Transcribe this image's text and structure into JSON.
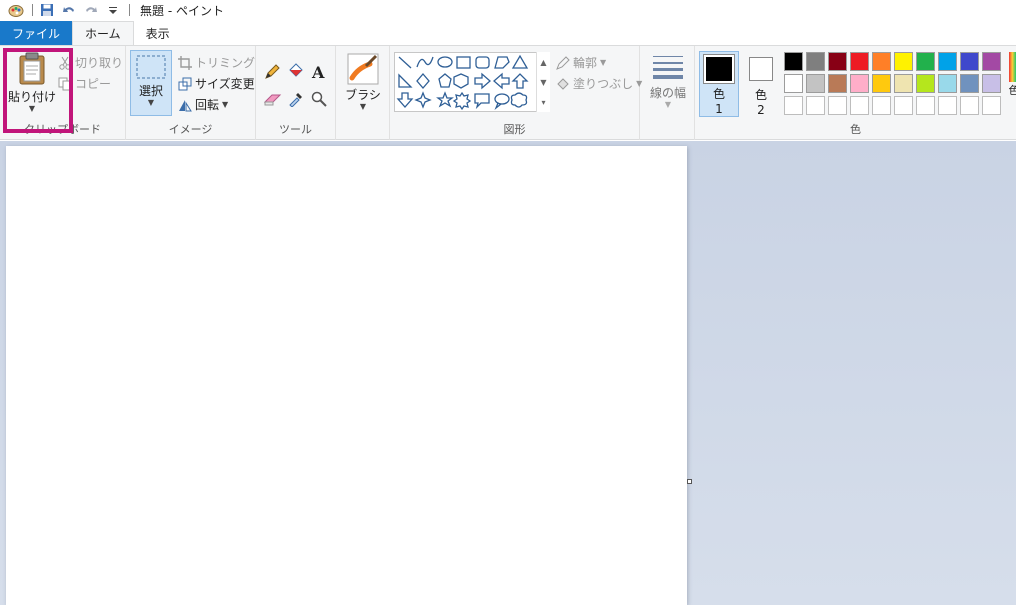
{
  "window": {
    "title": "無題 - ペイント"
  },
  "tabs": [
    {
      "label": "ファイル"
    },
    {
      "label": "ホーム"
    },
    {
      "label": "表示"
    }
  ],
  "clipboard": {
    "paste_label": "貼り付け",
    "cut_label": "切り取り",
    "copy_label": "コピー",
    "group_label": "クリップボード"
  },
  "image": {
    "select_label": "選択",
    "crop_label": "トリミング",
    "resize_label": "サイズ変更",
    "rotate_label": "回転",
    "group_label": "イメージ"
  },
  "tools": {
    "group_label": "ツール"
  },
  "brushes": {
    "label": "ブラシ"
  },
  "shapes": {
    "outline_label": "輪郭",
    "fill_label": "塗りつぶし",
    "group_label": "図形"
  },
  "size": {
    "label": "線の幅"
  },
  "colors": {
    "color1_label": "色",
    "color1_num": "1",
    "color2_label": "色",
    "color2_num": "2",
    "edit_label": "色",
    "group_label": "色",
    "palette": [
      [
        "#000000",
        "#7f7f7f",
        "#880015",
        "#ed1c24",
        "#ff7f27",
        "#fff200",
        "#22b14c",
        "#00a2e8",
        "#3f48cc",
        "#a349a4"
      ],
      [
        "#ffffff",
        "#c3c3c3",
        "#b97a57",
        "#ffaec9",
        "#ffc90e",
        "#efe4b0",
        "#b5e61d",
        "#99d9ea",
        "#7092be",
        "#c8bfe7"
      ],
      [
        "#ffffff",
        "#ffffff",
        "#ffffff",
        "#ffffff",
        "#ffffff",
        "#ffffff",
        "#ffffff",
        "#ffffff",
        "#ffffff",
        "#ffffff"
      ]
    ]
  }
}
